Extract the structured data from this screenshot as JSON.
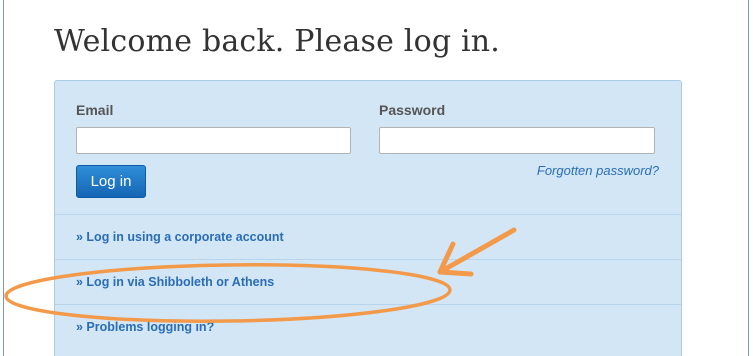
{
  "page": {
    "title": "Welcome back. Please log in."
  },
  "login_form": {
    "email_label": "Email",
    "email_value": "",
    "password_label": "Password",
    "password_value": "",
    "login_button_label": "Log in",
    "forgot_password_label": "Forgotten password?"
  },
  "options": {
    "corporate_label": "» Log in using a corporate account",
    "shibboleth_label": "» Log in via Shibboleth or Athens",
    "problems_label": "» Problems logging in?"
  },
  "annotation": {
    "color": "#f39a4a",
    "shapes": [
      "arrow-icon",
      "ellipse-highlight"
    ]
  }
}
